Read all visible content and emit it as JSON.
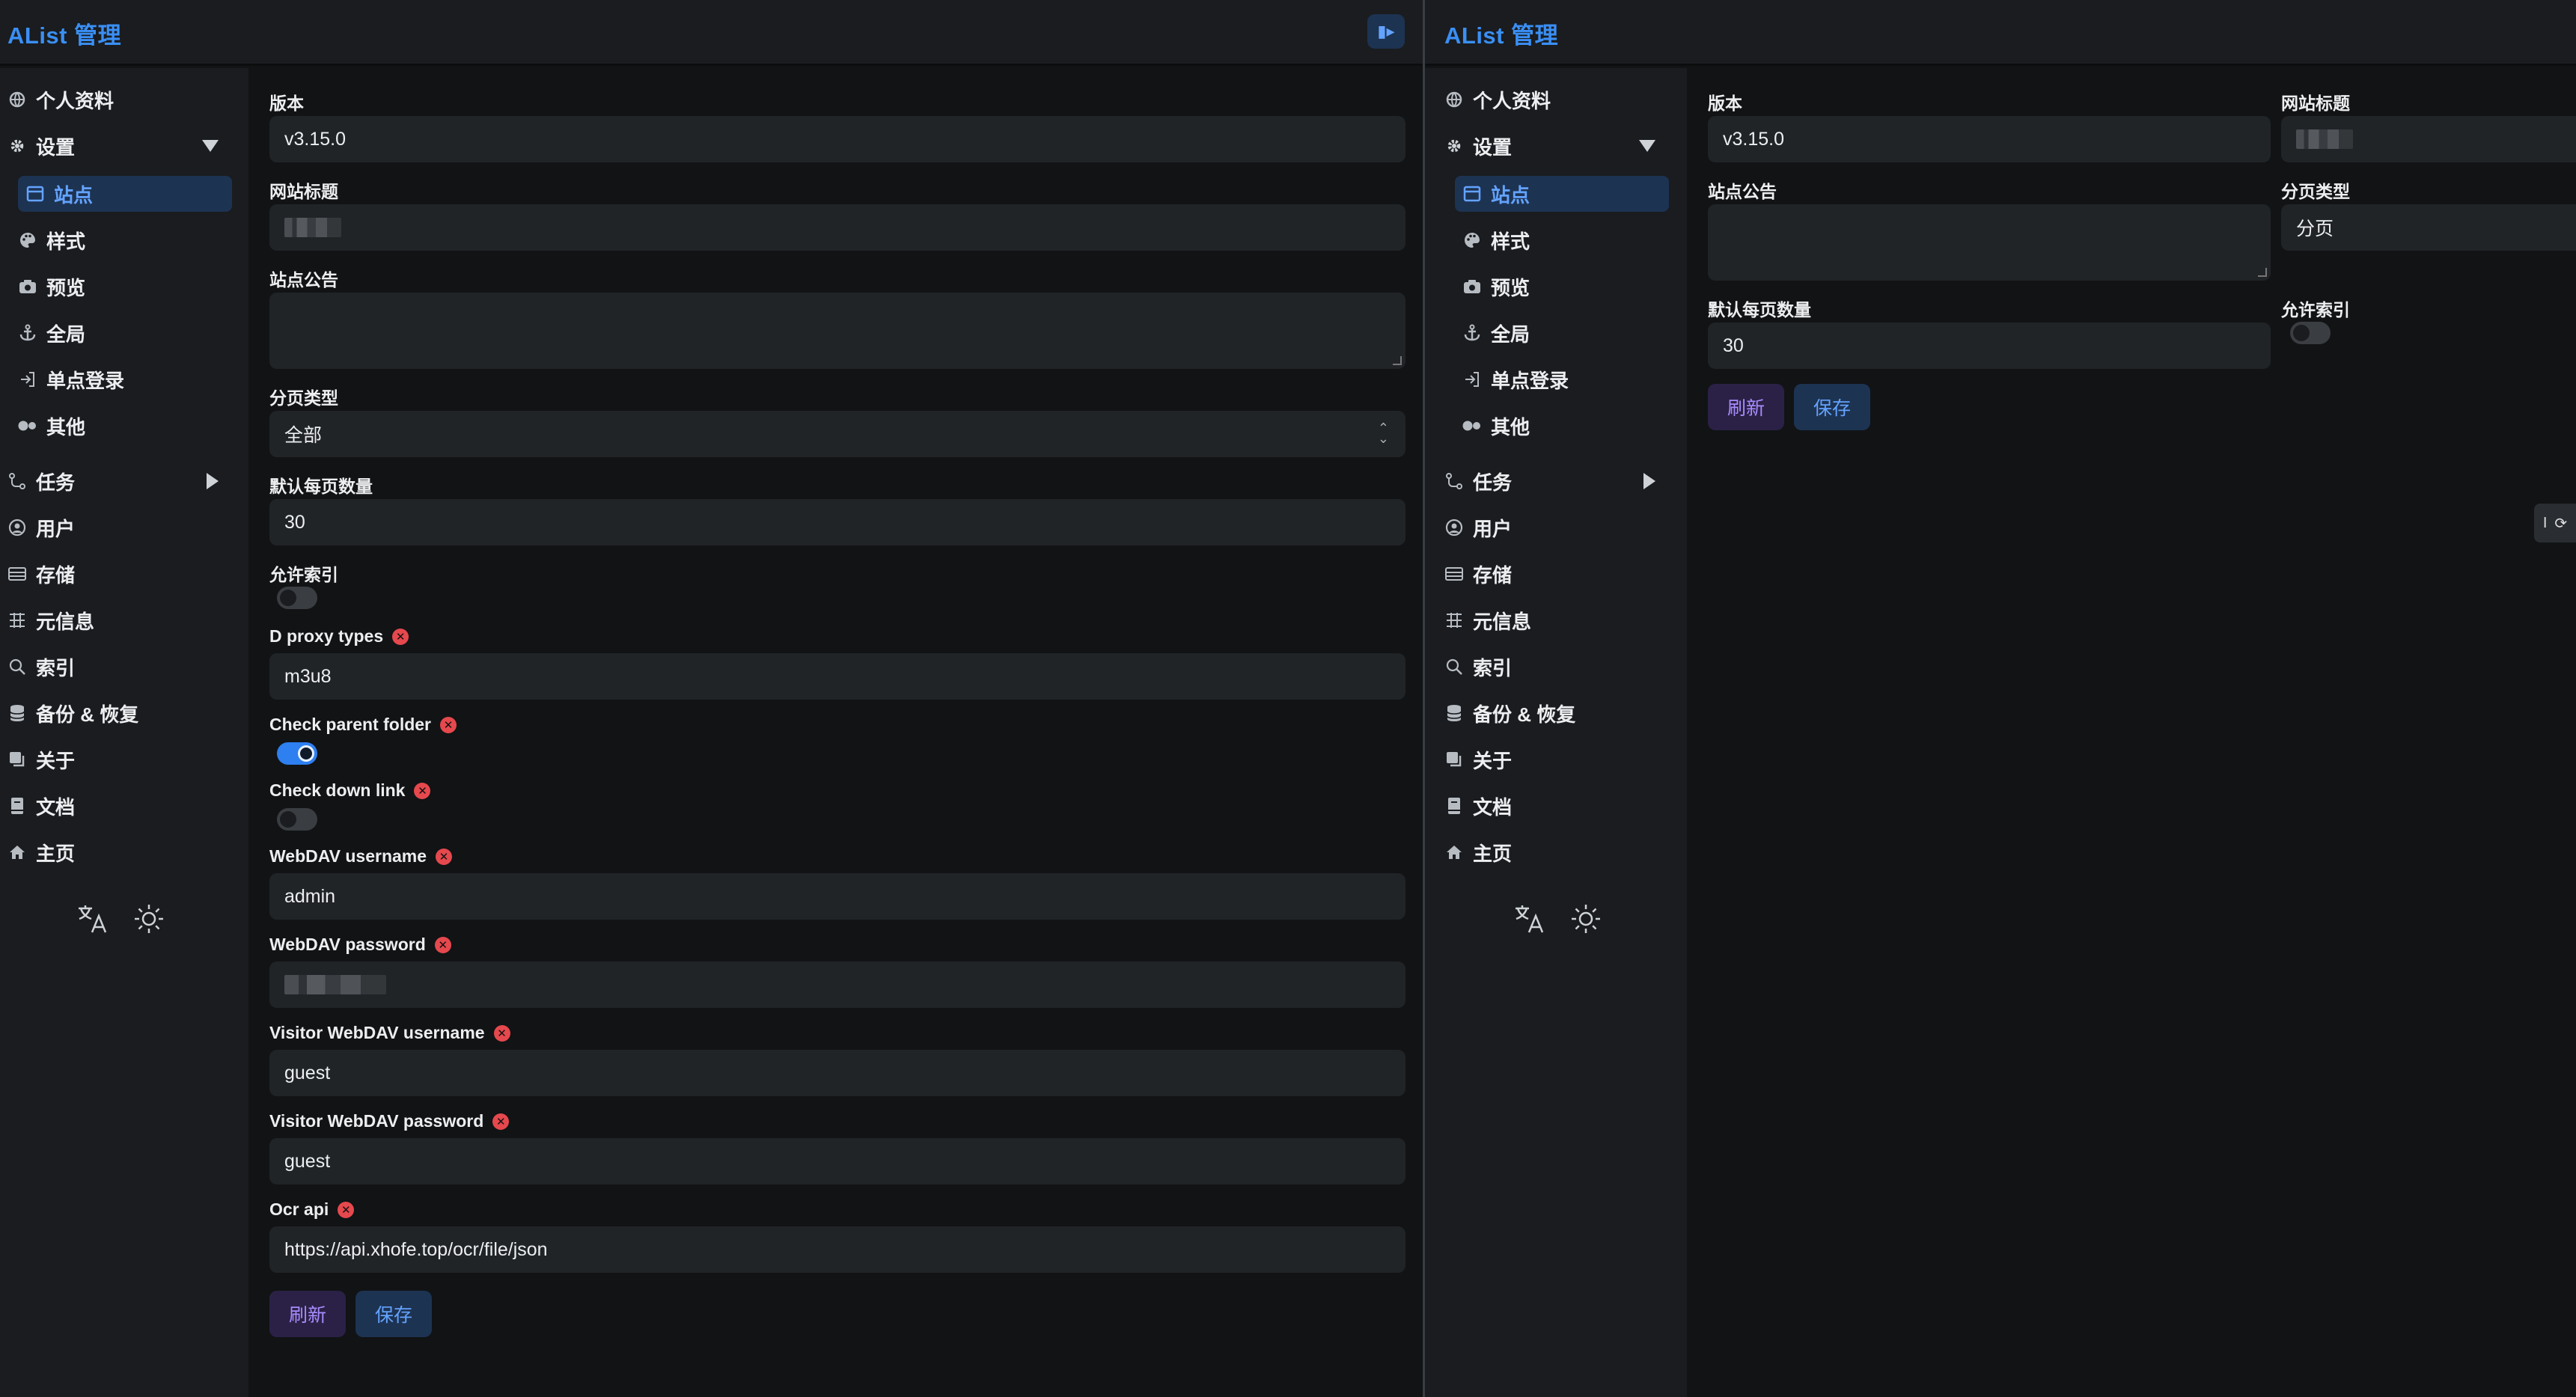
{
  "brand": "AList 管理",
  "sidebar": {
    "profile": "个人资料",
    "settings": "设置",
    "site": "站点",
    "style": "样式",
    "preview": "预览",
    "global": "全局",
    "sso": "单点登录",
    "other": "其他",
    "tasks": "任务",
    "users": "用户",
    "storage": "存储",
    "meta": "元信息",
    "index": "索引",
    "backup": "备份 & 恢复",
    "about": "关于",
    "docs": "文档",
    "home": "主页"
  },
  "labels": {
    "version": "版本",
    "site_title": "网站标题",
    "announcement": "站点公告",
    "pagination_type": "分页类型",
    "default_page_size": "默认每页数量",
    "allow_indexed": "允许索引",
    "d_proxy_types": "D proxy types",
    "check_parent_folder": "Check parent folder",
    "check_down_link": "Check down link",
    "webdav_username": "WebDAV username",
    "webdav_password": "WebDAV password",
    "visitor_webdav_username": "Visitor WebDAV username",
    "visitor_webdav_password": "Visitor WebDAV password",
    "ocr_api": "Ocr api"
  },
  "values": {
    "version": "v3.15.0",
    "pagination_left": "全部",
    "pagination_right": "分页",
    "default_page_size": "30",
    "d_proxy_types": "m3u8",
    "webdav_username": "admin",
    "visitor_webdav_username": "guest",
    "visitor_webdav_password": "guest",
    "ocr_api": "https://api.xhofe.top/ocr/file/json",
    "allow_indexed": false,
    "check_parent_folder": true,
    "check_down_link": false
  },
  "buttons": {
    "refresh": "刷新",
    "save": "保存"
  },
  "edge_tab": "I",
  "colors": {
    "accent": "#3a8ff5",
    "active_bg": "#1d3352",
    "refresh_text": "#a88cff",
    "danger": "#e5484d"
  }
}
